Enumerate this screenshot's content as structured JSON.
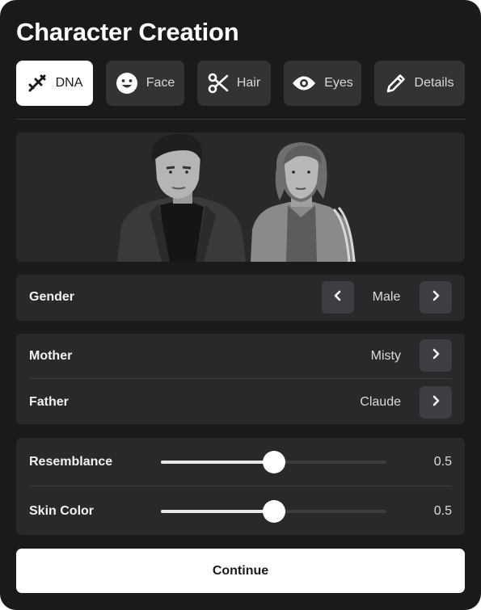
{
  "title": "Character Creation",
  "tabs": [
    {
      "label": "DNA",
      "icon": "dna-icon",
      "active": true
    },
    {
      "label": "Face",
      "icon": "smiley-face-icon",
      "active": false
    },
    {
      "label": "Hair",
      "icon": "scissors-icon",
      "active": false
    },
    {
      "label": "Eyes",
      "icon": "eye-icon",
      "active": false
    },
    {
      "label": "Details",
      "icon": "pencil-icon",
      "active": false
    }
  ],
  "preview": {
    "characters": [
      "male-character",
      "female-character"
    ]
  },
  "gender": {
    "label": "Gender",
    "value": "Male"
  },
  "parents": {
    "mother": {
      "label": "Mother",
      "value": "Misty"
    },
    "father": {
      "label": "Father",
      "value": "Claude"
    }
  },
  "sliders": {
    "resemblance": {
      "label": "Resemblance",
      "value": "0.5",
      "level": 0.5
    },
    "skin_color": {
      "label": "Skin Color",
      "value": "0.5",
      "level": 0.5
    }
  },
  "continue_label": "Continue",
  "colors": {
    "panel": "#1a1a1c",
    "card": "#29292b",
    "button": "#3e3e42",
    "active_tab": "#ffffff",
    "accent_text": "#ffffff"
  }
}
